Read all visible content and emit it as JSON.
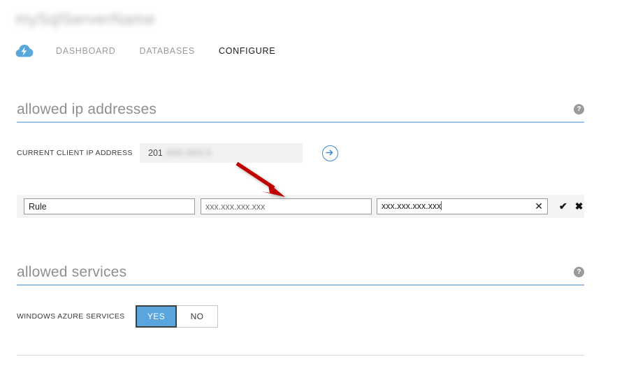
{
  "header": {
    "title_redacted": "mySqlServerName",
    "brand_icon": "azure-sql-cloud-icon",
    "tabs": [
      {
        "label": "DASHBOARD",
        "active": false
      },
      {
        "label": "DATABASES",
        "active": false
      },
      {
        "label": "CONFIGURE",
        "active": true
      }
    ]
  },
  "allowed_ip": {
    "section_title": "allowed ip addresses",
    "help_glyph": "?",
    "current_ip_label": "CURRENT CLIENT IP ADDRESS",
    "current_ip_visible": "201",
    "current_ip_redacted": ".XXX.XXX.X",
    "add_arrow_name": "add-current-ip-arrow",
    "rule": {
      "name_value": "Rule",
      "name_placeholder": "Rule",
      "start_ip_placeholder": "xxx.xxx.xxx.xxx",
      "start_ip_value": "",
      "end_ip_value": "xxx.xxx.xxx.xxx",
      "clear_glyph": "✕",
      "confirm_glyph": "✔",
      "cancel_glyph": "✖"
    }
  },
  "allowed_services": {
    "section_title": "allowed services",
    "help_glyph": "?",
    "row_label": "WINDOWS AZURE SERVICES",
    "toggle": {
      "yes_label": "YES",
      "no_label": "NO",
      "selected": "YES"
    }
  },
  "colors": {
    "accent_blue": "#58a6dd",
    "rule_blue": "#9dc3e6",
    "annotation_red": "#c00000",
    "readonly_grey": "#f2f2f2"
  }
}
